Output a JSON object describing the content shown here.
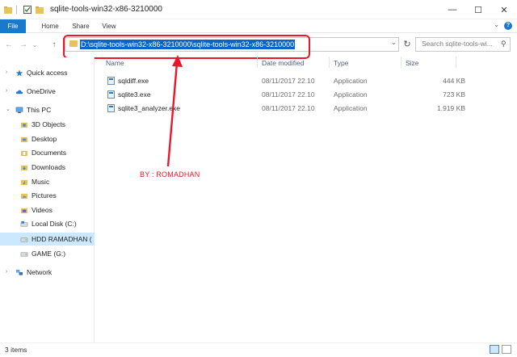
{
  "window": {
    "title": "sqlite-tools-win32-x86-3210000",
    "minimize": "—",
    "maximize": "☐",
    "close": "✕"
  },
  "ribbon": {
    "tabs": [
      "File",
      "Home",
      "Share",
      "View"
    ],
    "help": "?"
  },
  "nav": {
    "back": "←",
    "forward": "→",
    "recent": "⌄",
    "up": "↑",
    "address": "D:\\sqlite-tools-win32-x86-3210000\\sqlite-tools-win32-x86-3210000",
    "search_placeholder": "Search sqlite-tools-wi..."
  },
  "sidebar": {
    "items": [
      {
        "label": "Quick access",
        "icon": "star-icon"
      },
      {
        "label": "OneDrive",
        "icon": "cloud-icon"
      },
      {
        "label": "This PC",
        "icon": "computer-icon"
      },
      {
        "label": "3D Objects",
        "icon": "folder-icon"
      },
      {
        "label": "Desktop",
        "icon": "folder-icon"
      },
      {
        "label": "Documents",
        "icon": "folder-icon"
      },
      {
        "label": "Downloads",
        "icon": "folder-icon"
      },
      {
        "label": "Music",
        "icon": "folder-icon"
      },
      {
        "label": "Pictures",
        "icon": "folder-icon"
      },
      {
        "label": "Videos",
        "icon": "folder-icon"
      },
      {
        "label": "Local Disk (C:)",
        "icon": "drive-icon"
      },
      {
        "label": "HDD RAMADHAN (",
        "icon": "drive-icon"
      },
      {
        "label": "GAME  (G:)",
        "icon": "drive-icon"
      },
      {
        "label": "Network",
        "icon": "network-icon"
      }
    ]
  },
  "columns": {
    "name": "Name",
    "date": "Date modified",
    "type": "Type",
    "size": "Size"
  },
  "files": [
    {
      "name": "sqldiff.exe",
      "date": "08/11/2017 22.10",
      "type": "Application",
      "size": "444 KB"
    },
    {
      "name": "sqlite3.exe",
      "date": "08/11/2017 22.10",
      "type": "Application",
      "size": "723 KB"
    },
    {
      "name": "sqlite3_analyzer.exe",
      "date": "08/11/2017 22.10",
      "type": "Application",
      "size": "1.919 KB"
    }
  ],
  "annotation": {
    "text": "BY : ROMADHAN",
    "color": "#e8182a"
  },
  "status": {
    "items_count": "3 items"
  },
  "colors": {
    "accent": "#1979ca",
    "selection": "#cce8ff",
    "address_highlight": "#0a64c8"
  }
}
